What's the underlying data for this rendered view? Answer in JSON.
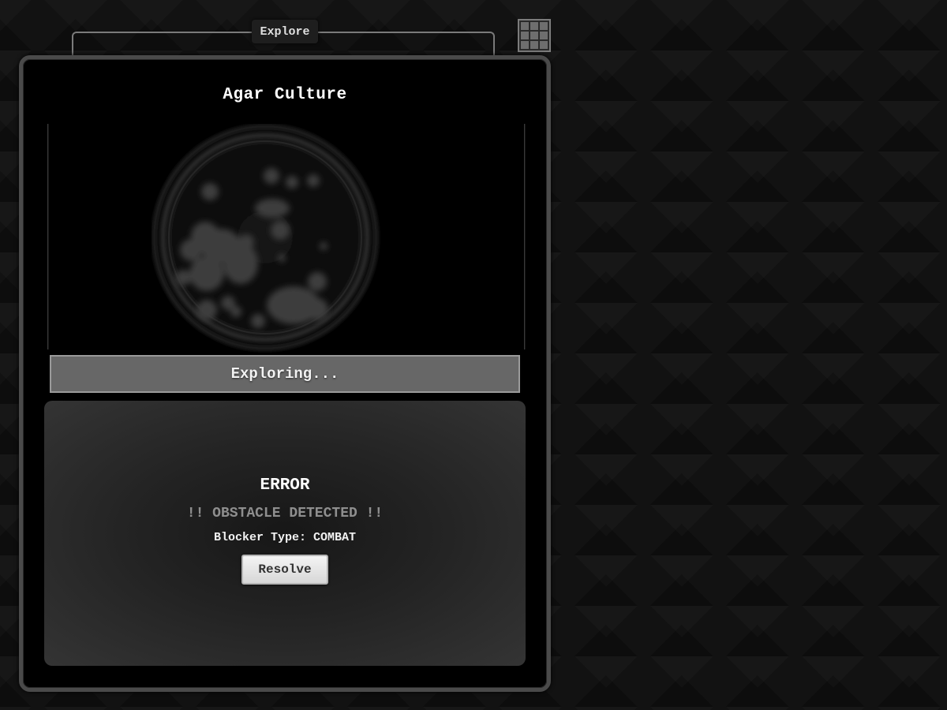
{
  "tabs": {
    "explore_label": "Explore"
  },
  "menu": {
    "icon": "grid-icon"
  },
  "location": {
    "title": "Agar Culture",
    "image": "petri-dish-illustration"
  },
  "progress": {
    "label": "Exploring...",
    "value": 1.0
  },
  "event": {
    "heading": "ERROR",
    "alert": "!! OBSTACLE DETECTED !!",
    "detail": "Blocker Type: COMBAT",
    "resolve_label": "Resolve"
  },
  "colors": {
    "background": "#121212",
    "panel": "#000000",
    "panel_border": "#4a4a4a",
    "progress_fill": "#676767",
    "alert_text": "#8e8e8e"
  }
}
